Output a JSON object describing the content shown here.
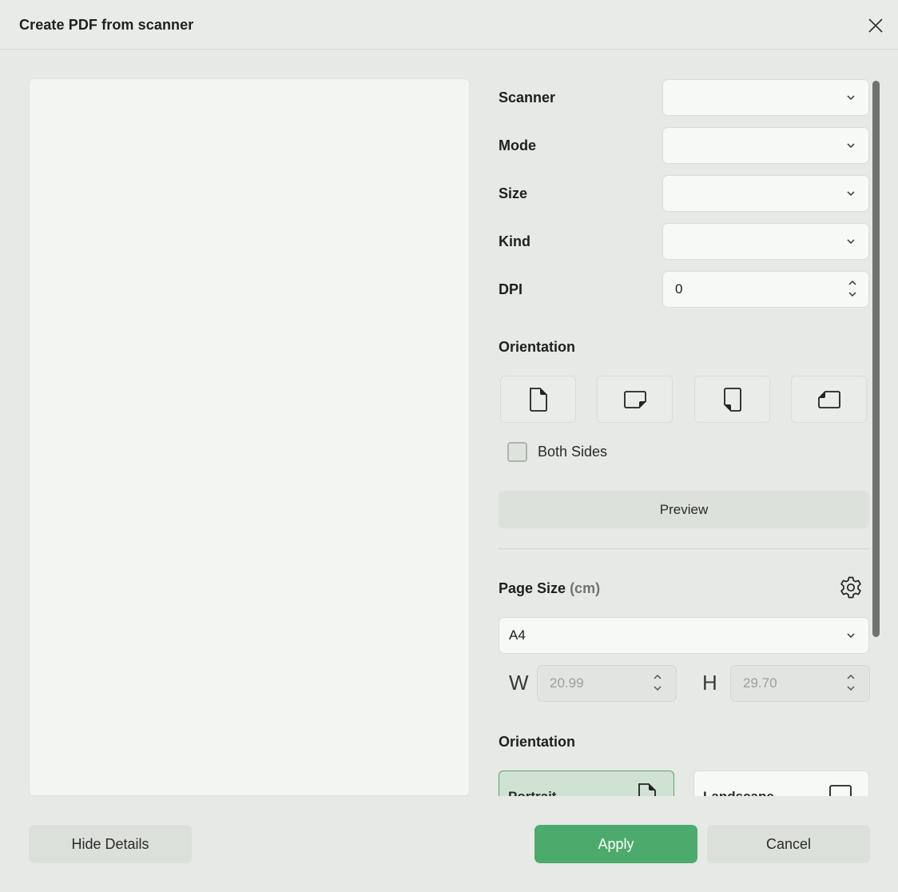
{
  "dialog": {
    "title": "Create PDF from scanner"
  },
  "scanner_settings": {
    "scanner_label": "Scanner",
    "scanner_value": "",
    "mode_label": "Mode",
    "mode_value": "",
    "size_label": "Size",
    "size_value": "",
    "kind_label": "Kind",
    "kind_value": "",
    "dpi_label": "DPI",
    "dpi_value": "0",
    "orientation_title": "Orientation",
    "orientation_icons": [
      "page-portrait-icon",
      "page-landscape-icon",
      "page-portrait-flipped-icon",
      "page-landscape-flipped-icon"
    ],
    "both_sides_label": "Both Sides",
    "both_sides_checked": false,
    "preview_button": "Preview"
  },
  "page_size": {
    "title": "Page Size",
    "unit": "(cm)",
    "preset": "A4",
    "width_label": "W",
    "width_value": "20.99",
    "height_label": "H",
    "height_value": "29.70"
  },
  "page_orientation": {
    "title": "Orientation",
    "options": [
      {
        "label": "Portrait",
        "selected": true
      },
      {
        "label": "Landscape",
        "selected": false
      }
    ]
  },
  "footer": {
    "hide_details": "Hide Details",
    "apply": "Apply",
    "cancel": "Cancel"
  },
  "colors": {
    "accent": "#4caa6d",
    "background": "#e6e9e5",
    "selected_card": "#cfe2d3"
  }
}
